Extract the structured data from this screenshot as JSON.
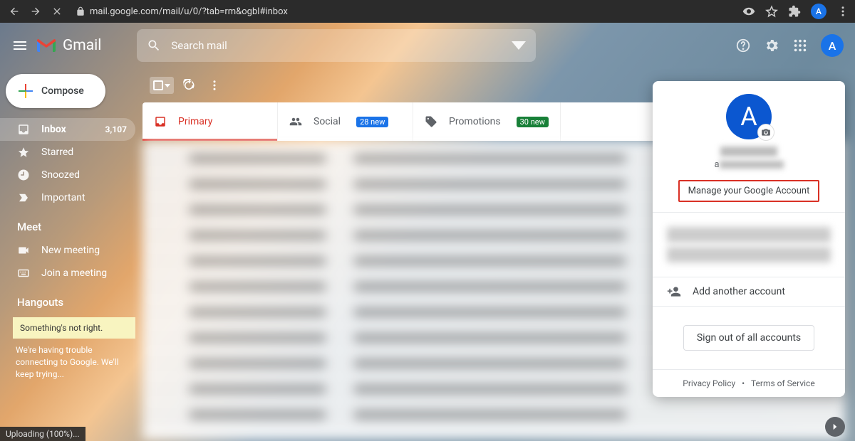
{
  "browser": {
    "url": "mail.google.com/mail/u/0/?tab=rm&ogbl#inbox",
    "avatar_letter": "A"
  },
  "header": {
    "product": "Gmail",
    "search_placeholder": "Search mail",
    "avatar_letter": "A"
  },
  "compose_label": "Compose",
  "sidebar": {
    "items": [
      {
        "label": "Inbox",
        "count": "3,107"
      },
      {
        "label": "Starred"
      },
      {
        "label": "Snoozed"
      },
      {
        "label": "Important"
      }
    ],
    "meet": {
      "title": "Meet",
      "items": [
        {
          "label": "New meeting"
        },
        {
          "label": "Join a meeting"
        }
      ]
    },
    "hangouts": {
      "title": "Hangouts",
      "warning": "Something's not right.",
      "message": "We're having trouble connecting to Google. We'll keep trying..."
    }
  },
  "tabs": {
    "primary": "Primary",
    "social": {
      "label": "Social",
      "badge": "28 new"
    },
    "promotions": {
      "label": "Promotions",
      "badge": "30 new"
    }
  },
  "account_popup": {
    "avatar_letter": "A",
    "email_prefix": "a",
    "manage": "Manage your Google Account",
    "add_account": "Add another account",
    "signout": "Sign out of all accounts",
    "privacy": "Privacy Policy",
    "terms": "Terms of Service"
  },
  "status_bar": "Uploading (100%)..."
}
